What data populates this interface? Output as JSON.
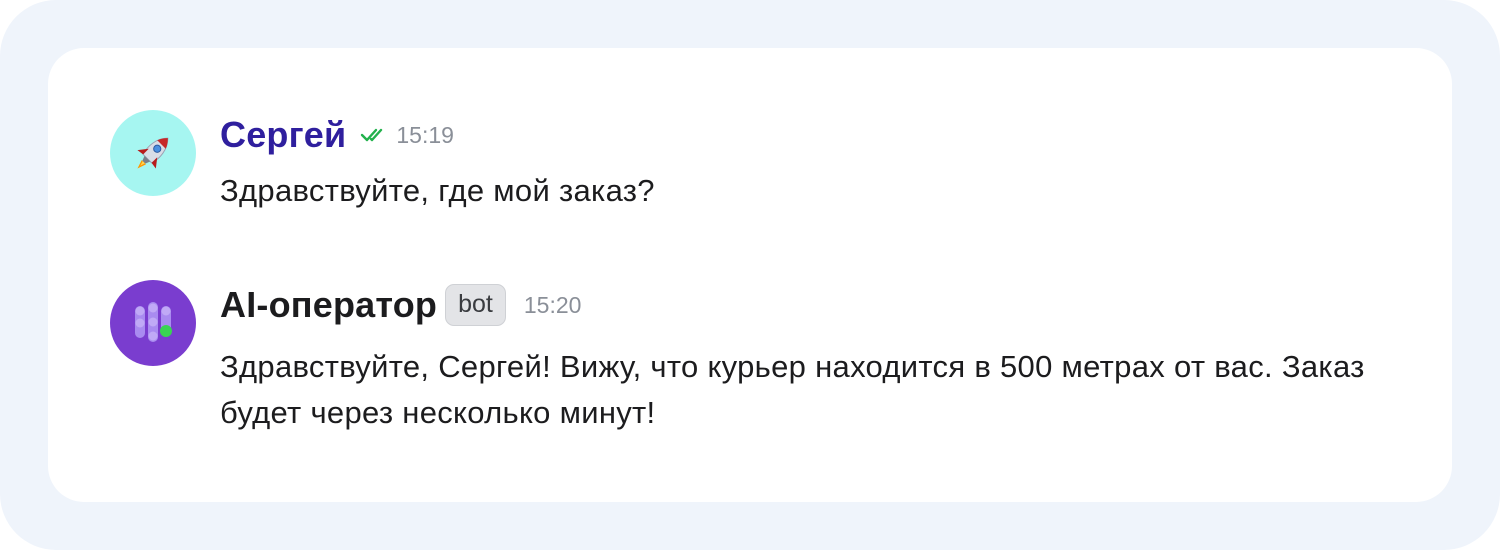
{
  "messages": [
    {
      "author": "Сергей",
      "time": "15:19",
      "status_icon": "double-check-icon",
      "avatar_icon": "rocket-icon",
      "text": "Здравствуйте, где мой заказ?"
    },
    {
      "author": "AI-оператор",
      "badge": "bot",
      "time": "15:20",
      "avatar_icon": "ai-operator-logo-icon",
      "text": "Здравствуйте, Сергей! Вижу, что курьер находится в 500 метрах от вас. Заказ будет через несколько минут!"
    }
  ],
  "colors": {
    "outer_bg": "#eff4fb",
    "card_bg": "#ffffff",
    "user_name": "#2f1f9e",
    "read_check": "#22b14c",
    "user_avatar_bg": "#a6f6f1",
    "bot_avatar_bg": "#7a3dcf",
    "time": "#8a8f98"
  }
}
